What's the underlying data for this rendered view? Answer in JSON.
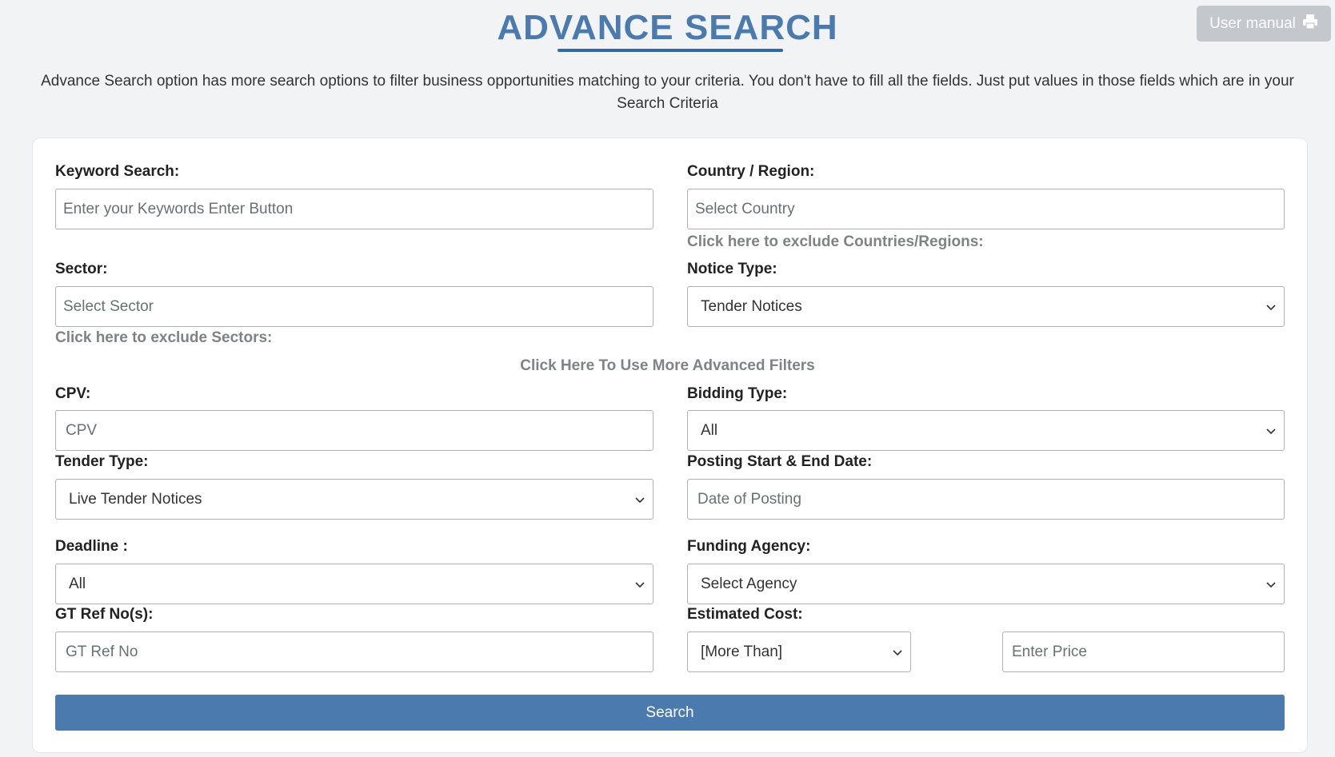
{
  "page": {
    "title": "ADVANCE SEARCH",
    "user_manual_label": "User manual",
    "intro": "Advance Search option has more search options to filter business opportunities matching to your criteria. You don't have to fill all the fields. Just put values in those fields which are in your Search Criteria"
  },
  "form": {
    "keyword": {
      "label": "Keyword Search:",
      "placeholder": "Enter your Keywords Enter Button"
    },
    "country": {
      "label": "Country / Region:",
      "placeholder": "Select Country",
      "exclude_link": "Click here to exclude Countries/Regions:"
    },
    "sector": {
      "label": "Sector:",
      "placeholder": "Select Sector",
      "exclude_link": "Click here to exclude Sectors:"
    },
    "notice_type": {
      "label": "Notice Type:",
      "value": "Tender Notices"
    },
    "more_filters_link": "Click Here To Use More Advanced Filters",
    "cpv": {
      "label": "CPV:",
      "placeholder": "CPV"
    },
    "bidding_type": {
      "label": "Bidding Type:",
      "value": "All"
    },
    "tender_type": {
      "label": "Tender Type:",
      "value": "Live Tender Notices"
    },
    "posting_date": {
      "label": "Posting Start & End Date:",
      "placeholder": "Date of Posting"
    },
    "deadline": {
      "label": "Deadline :",
      "value": "All"
    },
    "funding_agency": {
      "label": "Funding Agency:",
      "value": "Select Agency"
    },
    "gt_ref": {
      "label": "GT Ref No(s):",
      "placeholder": "GT Ref No"
    },
    "estimated_cost": {
      "label": "Estimated Cost:",
      "operator": "[More Than]",
      "price_placeholder": "Enter Price"
    },
    "search_label": "Search"
  },
  "colors": {
    "accent": "#4a7aae",
    "underline": "#2f6aa6",
    "link_gray": "#808285"
  },
  "icons": {
    "manual": "printer-icon",
    "select": "chevron-down-icon"
  }
}
